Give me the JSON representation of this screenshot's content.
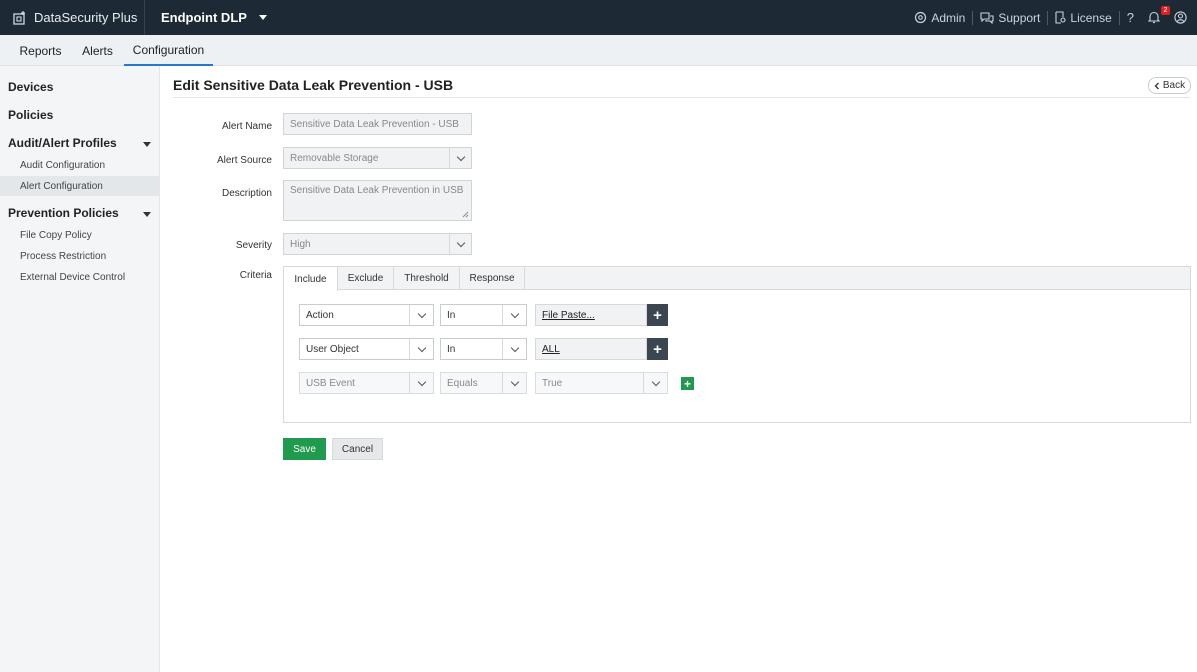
{
  "header": {
    "brand": "DataSecurity Plus",
    "product": "Endpoint DLP",
    "admin": "Admin",
    "support": "Support",
    "license": "License",
    "help": "?",
    "notification_count": "2"
  },
  "tabs": [
    {
      "label": "Reports"
    },
    {
      "label": "Alerts"
    },
    {
      "label": "Configuration",
      "active": true
    }
  ],
  "sidebar": {
    "devices": "Devices",
    "policies": "Policies",
    "audit_alert_profiles": "Audit/Alert Profiles",
    "audit_configuration": "Audit Configuration",
    "alert_configuration": "Alert Configuration",
    "prevention_policies": "Prevention Policies",
    "file_copy_policy": "File Copy Policy",
    "process_restriction": "Process Restriction",
    "external_device_control": "External Device Control"
  },
  "page": {
    "title": "Edit Sensitive Data Leak Prevention - USB",
    "back": "Back"
  },
  "form": {
    "alert_name_label": "Alert Name",
    "alert_name_value": "Sensitive Data Leak Prevention - USB",
    "alert_source_label": "Alert Source",
    "alert_source_value": "Removable Storage",
    "description_label": "Description",
    "description_value": "Sensitive Data Leak Prevention in USB",
    "severity_label": "Severity",
    "severity_value": "High",
    "criteria_label": "Criteria"
  },
  "criteria": {
    "tabs": [
      "Include",
      "Exclude",
      "Threshold",
      "Response"
    ],
    "rows": [
      {
        "field": "Action",
        "operator": "In",
        "value": "File Paste..."
      },
      {
        "field": "User Object",
        "operator": "In",
        "value": "ALL"
      },
      {
        "field": "USB Event",
        "operator": "Equals",
        "value": "True"
      }
    ]
  },
  "actions": {
    "save": "Save",
    "cancel": "Cancel"
  },
  "colors": {
    "header_bg": "#1d2a35",
    "accent": "#2a77c9",
    "save_green": "#1f9a4e"
  }
}
